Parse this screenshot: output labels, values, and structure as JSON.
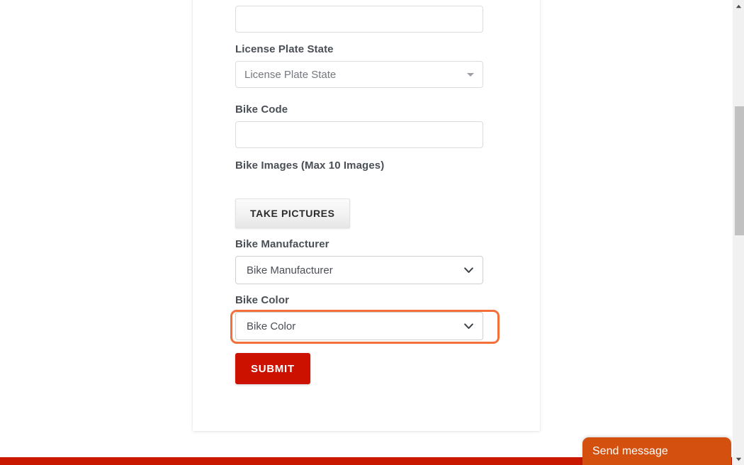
{
  "page": {
    "background_color": "#ffffff",
    "card_color": "#ffffff"
  },
  "form": {
    "fields": [
      {
        "id": "license-plate-number",
        "label": "",
        "type": "text",
        "value": "",
        "placeholder": ""
      },
      {
        "id": "license-plate-state",
        "label": "License Plate State",
        "type": "pseudo-select",
        "value": "License Plate State",
        "caret_icon": "caret-down-icon"
      },
      {
        "id": "bike-code",
        "label": "Bike Code",
        "type": "text",
        "value": "",
        "placeholder": ""
      },
      {
        "id": "bike-images",
        "label": "Bike Images (Max 10 Images)",
        "type": "file-button",
        "button_label": "TAKE PICTURES"
      },
      {
        "id": "bike-manufacturer",
        "label": "Bike Manufacturer",
        "type": "select",
        "value": "Bike Manufacturer",
        "options": [
          "Bike Manufacturer"
        ],
        "chevron_icon": "chevron-down-icon"
      },
      {
        "id": "bike-color",
        "label": "Bike Color",
        "type": "select",
        "value": "Bike Color",
        "options": [
          "Bike Color"
        ],
        "chevron_icon": "chevron-down-icon",
        "highlighted": true,
        "highlight_color": "#f4703a"
      }
    ],
    "submit_label": "SUBMIT",
    "submit_color": "#cc1100"
  },
  "chat_widget": {
    "label": "Send message",
    "background_color": "#d4500e"
  },
  "footer": {
    "bar_color": "#c81800"
  },
  "scrollbar": {
    "up_arrow_icon": "scroll-up-arrow-icon",
    "down_arrow_icon": "scroll-down-arrow-icon",
    "thumb_color": "#c1c1c1",
    "track_color": "#f1f1f1"
  }
}
